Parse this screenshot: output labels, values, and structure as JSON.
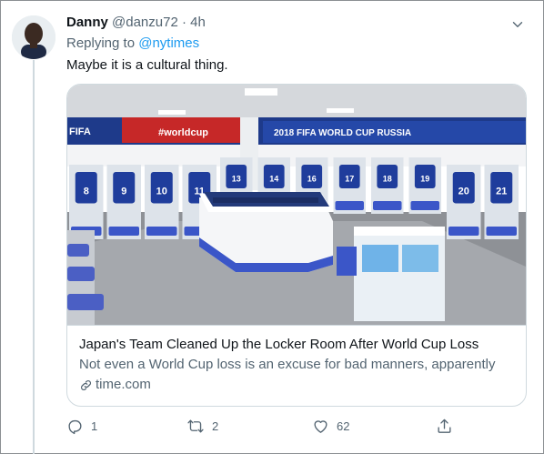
{
  "tweet": {
    "display_name": "Danny",
    "handle": "@danzu72",
    "separator": "·",
    "time": "4h",
    "replying_prefix": "Replying to",
    "replying_to": "@nytimes",
    "text": "Maybe it is a cultural thing."
  },
  "card": {
    "title": "Japan's Team Cleaned Up the Locker Room After World Cup Loss",
    "description": "Not even a World Cup loss is an excuse for bad manners, apparently",
    "domain": "time.com",
    "image": {
      "banner_left": "#worldcup",
      "banner_right": "2018 FIFA WORLD CUP RUSSIA",
      "fifa_text": "FIFA",
      "jersey_numbers": [
        "8",
        "9",
        "10",
        "11",
        "13",
        "14",
        "16",
        "17",
        "18",
        "19",
        "20",
        "21"
      ]
    }
  },
  "actions": {
    "reply_count": "1",
    "retweet_count": "2",
    "like_count": "62"
  },
  "colors": {
    "accent": "#1d9bf0",
    "secondary_text": "#536471",
    "border": "#cfd9de"
  },
  "icons": [
    "more-icon",
    "reply-icon",
    "retweet-icon",
    "like-icon",
    "share-icon",
    "link-icon"
  ]
}
